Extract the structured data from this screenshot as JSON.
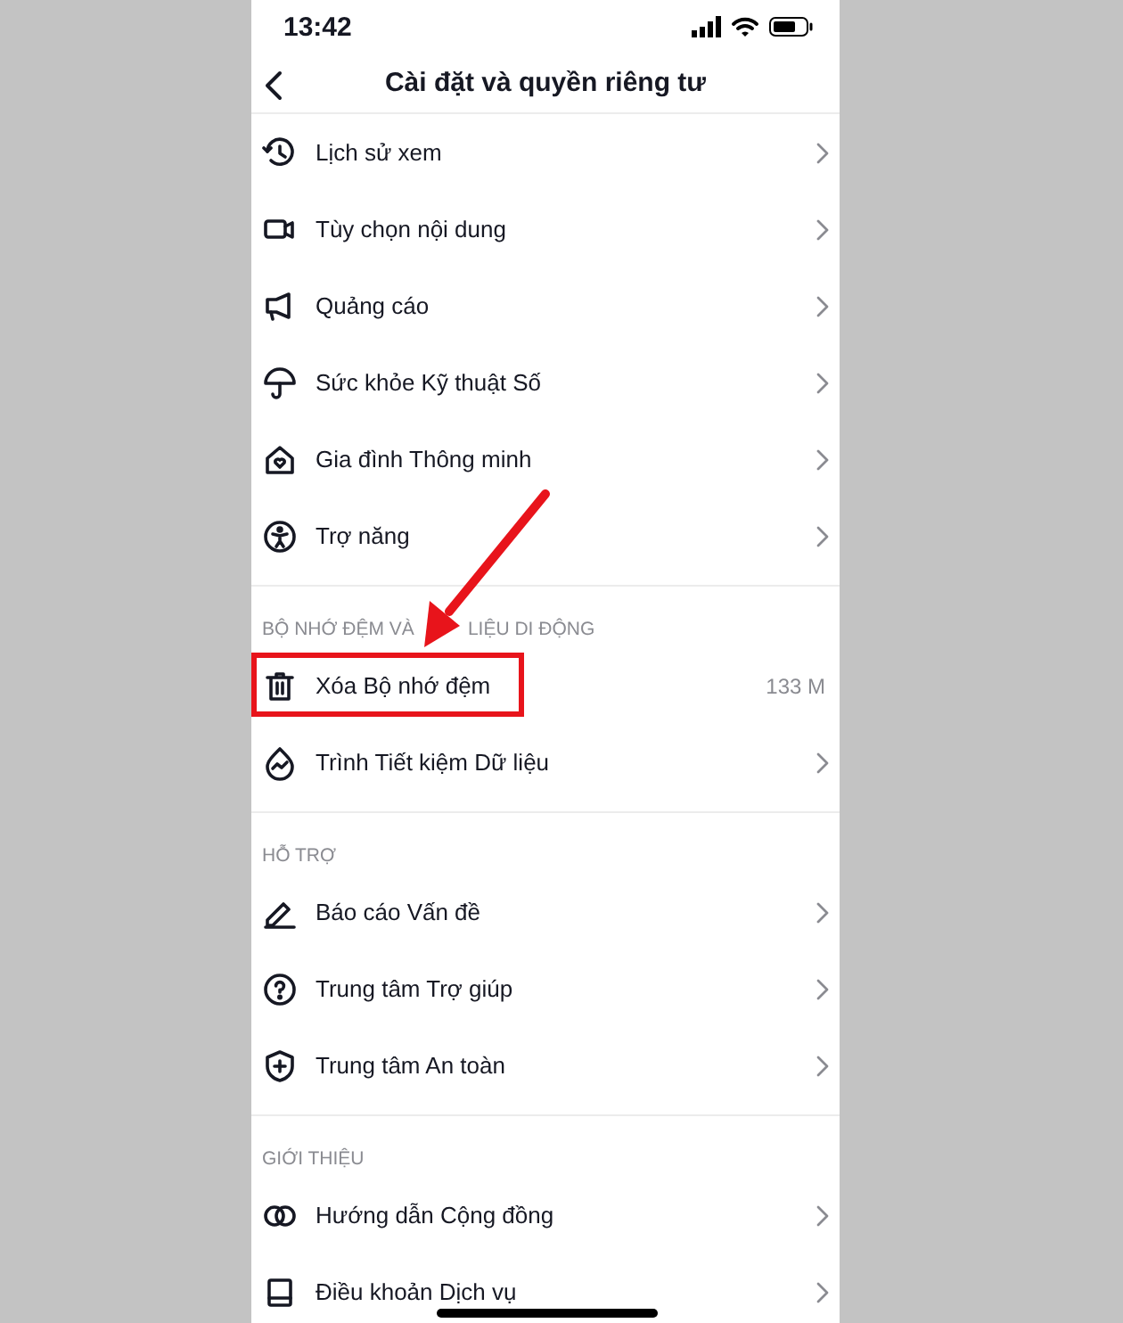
{
  "status_bar": {
    "time": "13:42"
  },
  "header": {
    "title": "Cài đặt và quyền riêng tư"
  },
  "sections": [
    {
      "items": [
        {
          "label": "Lịch sử xem",
          "kind": "link",
          "highlighted": false
        },
        {
          "label": "Tùy chọn nội dung",
          "kind": "link",
          "highlighted": false
        },
        {
          "label": "Quảng cáo",
          "kind": "link",
          "highlighted": false
        },
        {
          "label": "Sức khỏe Kỹ thuật Số",
          "kind": "link",
          "highlighted": false
        },
        {
          "label": "Gia đình Thông minh",
          "kind": "link",
          "highlighted": false
        },
        {
          "label": "Trợ năng",
          "kind": "link",
          "highlighted": false
        }
      ]
    },
    {
      "title_parts": [
        "BỘ NHỚ ĐỆM VÀ",
        "LIỆU DI ĐỘNG"
      ],
      "items": [
        {
          "label": "Xóa Bộ nhớ đệm",
          "kind": "value",
          "value": "133 M",
          "highlighted": true
        },
        {
          "label": "Trình Tiết kiệm Dữ liệu",
          "kind": "link",
          "highlighted": false
        }
      ]
    },
    {
      "title_parts": [
        "HỖ TRỢ"
      ],
      "items": [
        {
          "label": "Báo cáo Vấn đề",
          "kind": "link",
          "highlighted": false
        },
        {
          "label": "Trung tâm Trợ giúp",
          "kind": "link",
          "highlighted": false
        },
        {
          "label": "Trung tâm An toàn",
          "kind": "link",
          "highlighted": false
        }
      ]
    },
    {
      "title_parts": [
        "GIỚI THIỆU"
      ],
      "items": [
        {
          "label": "Hướng dẫn Cộng đồng",
          "kind": "link",
          "highlighted": false
        },
        {
          "label": "Điều khoản Dịch vụ",
          "kind": "link",
          "highlighted": false
        }
      ]
    }
  ]
}
